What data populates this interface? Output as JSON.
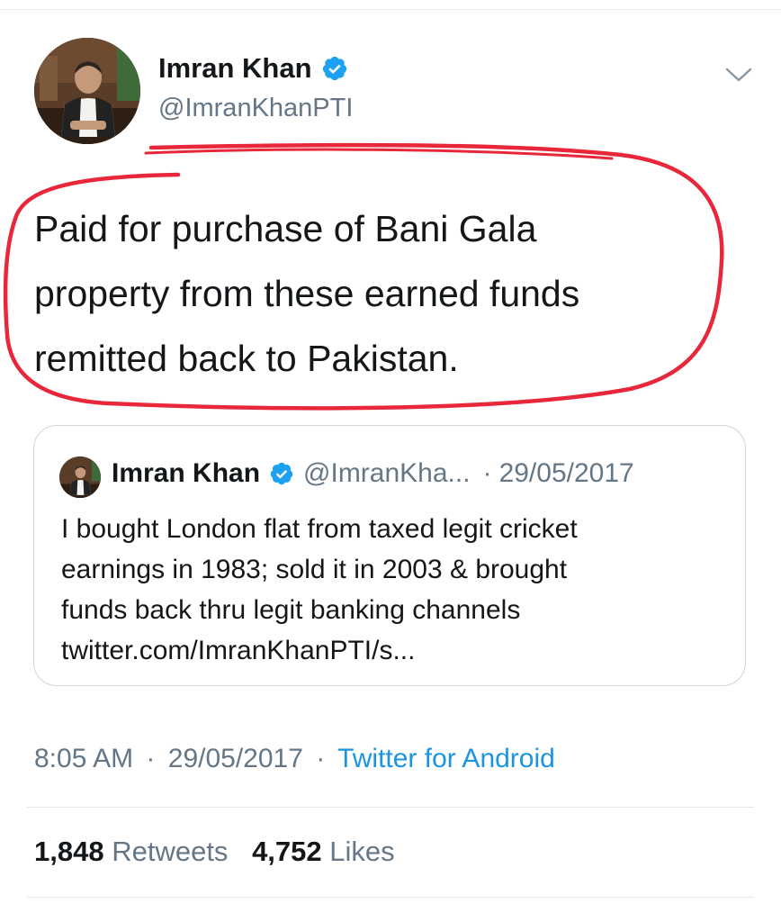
{
  "tweet": {
    "author": {
      "name": "Imran Khan",
      "handle": "@ImranKhanPTI",
      "avatar_icon": "profile-photo",
      "verified_icon": "verified-badge-icon"
    },
    "text_lines": [
      "Paid for purchase of Bani Gala",
      "property from these earned funds",
      "remitted back to Pakistan."
    ],
    "time": "8:05 AM",
    "date": "29/05/2017",
    "source": "Twitter for Android",
    "separator": "·"
  },
  "quoted": {
    "name": "Imran Khan",
    "handle": "@ImranKha...",
    "date": "29/05/2017",
    "separator": "·",
    "text_lines": [
      "I bought London flat from taxed legit cricket",
      "earnings in 1983; sold it in 2003 & brought",
      "funds back thru legit banking channels",
      "twitter.com/ImranKhanPTI/s..."
    ]
  },
  "stats": {
    "retweets_count": "1,848",
    "retweets_label": "Retweets",
    "likes_count": "4,752",
    "likes_label": "Likes"
  },
  "colors": {
    "verified": "#1da1f2",
    "link": "#1b95e0",
    "secondary_text": "#657786",
    "annotation": "#e8283a"
  },
  "icons": {
    "menu": "chevron-down-icon",
    "annotation": "red-hand-drawn-circle"
  }
}
